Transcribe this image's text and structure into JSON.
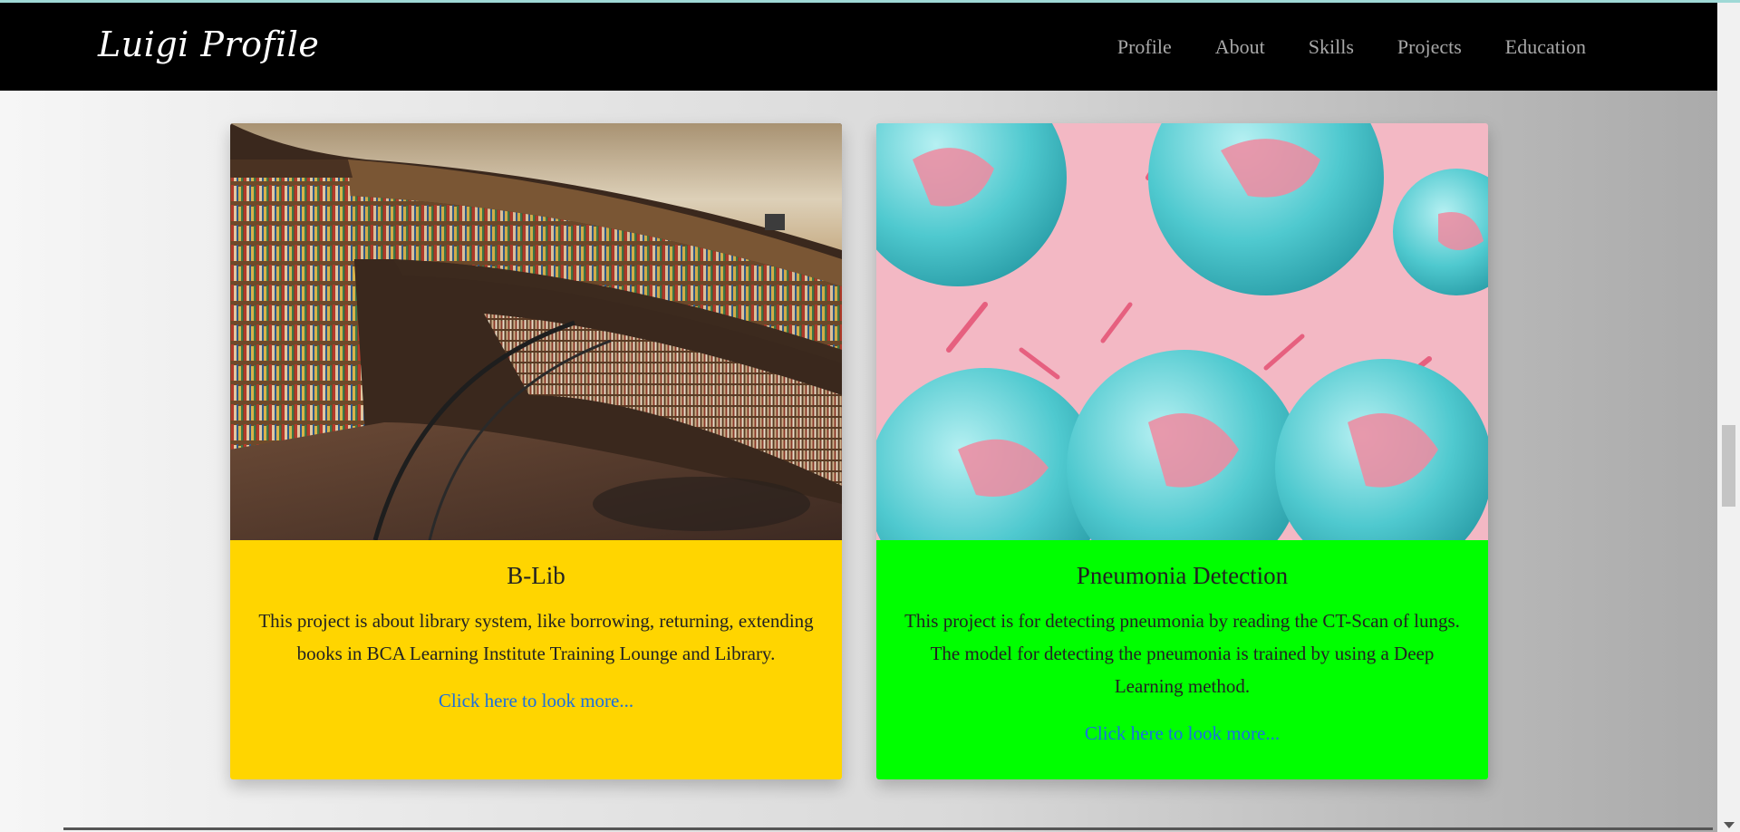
{
  "navbar": {
    "brand": "Luigi Profile",
    "links": [
      "Profile",
      "About",
      "Skills",
      "Projects",
      "Education"
    ]
  },
  "projects": [
    {
      "title": "B-Lib",
      "description": "This project is about library system, like borrowing, returning, extending books in BCA Learning Institute Training Lounge and Library.",
      "link_label": "Click here to look more...",
      "image": "library-photo",
      "color": "#ffd500"
    },
    {
      "title": "Pneumonia Detection",
      "description": "This project is for detecting pneumonia by reading the CT-Scan of lungs. The model for detecting the pneumonia is trained by using a Deep Learning method.",
      "link_label": "Click here to look more...",
      "image": "virus-illustration",
      "color": "#00ff00"
    }
  ]
}
